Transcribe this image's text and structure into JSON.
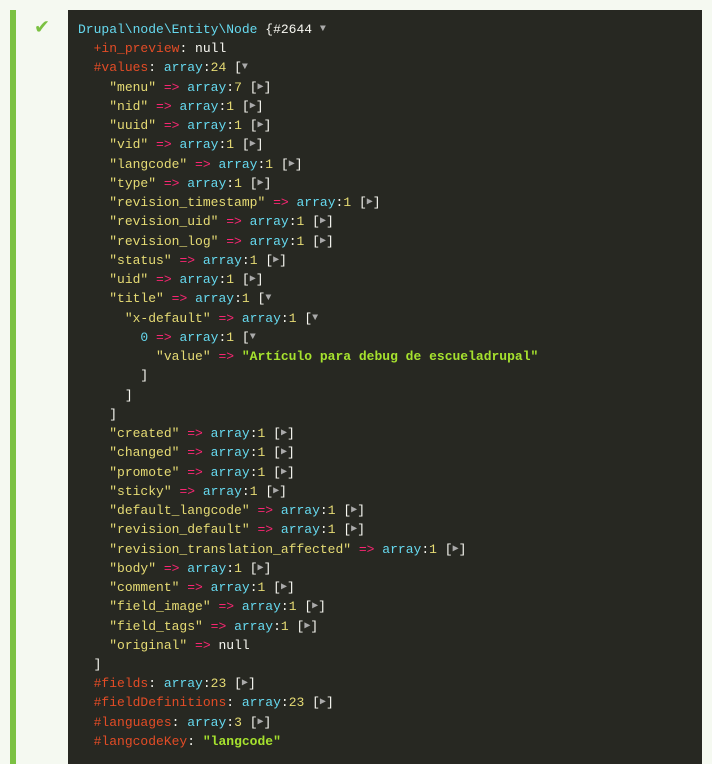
{
  "header": {
    "class_name": "Drupal\\node\\Entity\\Node",
    "hash": "#2644"
  },
  "in_preview": {
    "sigil": "+",
    "name": "in_preview",
    "value": "null"
  },
  "values": {
    "sigil": "#",
    "name": "values",
    "type": "array",
    "count": "24"
  },
  "rows": [
    {
      "key": "\"menu\"",
      "count": "7",
      "collapsed": true,
      "indent": 2
    },
    {
      "key": "\"nid\"",
      "count": "1",
      "collapsed": true,
      "indent": 2
    },
    {
      "key": "\"uuid\"",
      "count": "1",
      "collapsed": true,
      "indent": 2
    },
    {
      "key": "\"vid\"",
      "count": "1",
      "collapsed": true,
      "indent": 2
    },
    {
      "key": "\"langcode\"",
      "count": "1",
      "collapsed": true,
      "indent": 2
    },
    {
      "key": "\"type\"",
      "count": "1",
      "collapsed": true,
      "indent": 2
    },
    {
      "key": "\"revision_timestamp\"",
      "count": "1",
      "collapsed": true,
      "indent": 2
    },
    {
      "key": "\"revision_uid\"",
      "count": "1",
      "collapsed": true,
      "indent": 2
    },
    {
      "key": "\"revision_log\"",
      "count": "1",
      "collapsed": true,
      "indent": 2
    },
    {
      "key": "\"status\"",
      "count": "1",
      "collapsed": true,
      "indent": 2
    },
    {
      "key": "\"uid\"",
      "count": "1",
      "collapsed": true,
      "indent": 2
    }
  ],
  "title_block": {
    "title_key": "\"title\"",
    "title_count": "1",
    "xdefault_key": "\"x-default\"",
    "xdefault_count": "1",
    "zero_idx": "0",
    "zero_count": "1",
    "value_key": "\"value\"",
    "value_str": "\"Artículo para debug de escueladrupal\""
  },
  "rows2": [
    {
      "key": "\"created\"",
      "count": "1",
      "collapsed": true,
      "indent": 2
    },
    {
      "key": "\"changed\"",
      "count": "1",
      "collapsed": true,
      "indent": 2
    },
    {
      "key": "\"promote\"",
      "count": "1",
      "collapsed": true,
      "indent": 2
    },
    {
      "key": "\"sticky\"",
      "count": "1",
      "collapsed": true,
      "indent": 2
    },
    {
      "key": "\"default_langcode\"",
      "count": "1",
      "collapsed": true,
      "indent": 2
    },
    {
      "key": "\"revision_default\"",
      "count": "1",
      "collapsed": true,
      "indent": 2
    },
    {
      "key": "\"revision_translation_affected\"",
      "count": "1",
      "collapsed": true,
      "indent": 2
    },
    {
      "key": "\"body\"",
      "count": "1",
      "collapsed": true,
      "indent": 2
    },
    {
      "key": "\"comment\"",
      "count": "1",
      "collapsed": true,
      "indent": 2
    },
    {
      "key": "\"field_image\"",
      "count": "1",
      "collapsed": true,
      "indent": 2
    },
    {
      "key": "\"field_tags\"",
      "count": "1",
      "collapsed": true,
      "indent": 2
    }
  ],
  "original": {
    "key": "\"original\"",
    "value": "null"
  },
  "footer_props": [
    {
      "sigil": "#",
      "name": "fields",
      "count": "23"
    },
    {
      "sigil": "#",
      "name": "fieldDefinitions",
      "count": "23"
    },
    {
      "sigil": "#",
      "name": "languages",
      "count": "3"
    }
  ],
  "langcode_key": {
    "sigil": "#",
    "name": "langcodeKey",
    "value": "\"langcode\""
  },
  "glyphs": {
    "expanded": "▼",
    "collapsed": "▶"
  }
}
